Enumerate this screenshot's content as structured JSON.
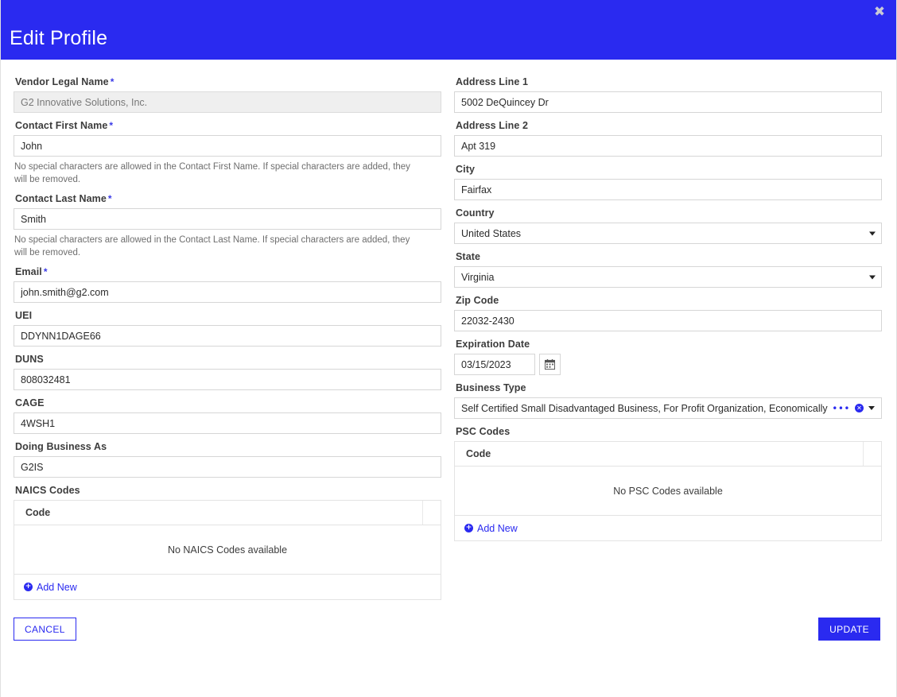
{
  "header": {
    "title": "Edit Profile",
    "close_icon": "close-icon",
    "close_glyph": "✖",
    "background_color": "#2A2AF0"
  },
  "theme": {
    "accent": "#2A2AF0",
    "required_mark": "*",
    "border": "#d6d6d6",
    "disabled_bg": "#efefef",
    "text": "#2b2b2b"
  },
  "left_column": {
    "vendor_legal_name": {
      "label": "Vendor Legal Name",
      "required": true,
      "value": "G2 Innovative Solutions, Inc.",
      "disabled": true
    },
    "contact_first_name": {
      "label": "Contact First Name",
      "required": true,
      "value": "John",
      "hint": "No special characters are allowed in the Contact First Name. If special characters are added, they will be removed."
    },
    "contact_last_name": {
      "label": "Contact Last Name",
      "required": true,
      "value": "Smith",
      "hint": "No special characters are allowed in the Contact Last Name. If special characters are added, they will be removed."
    },
    "email": {
      "label": "Email",
      "required": true,
      "value": "john.smith@g2.com"
    },
    "uei": {
      "label": "UEI",
      "required": false,
      "value": "DDYNN1DAGE66"
    },
    "duns": {
      "label": "DUNS",
      "required": false,
      "value": "808032481"
    },
    "cage": {
      "label": "CAGE",
      "required": false,
      "value": "4WSH1"
    },
    "doing_business_as": {
      "label": "Doing Business As",
      "required": false,
      "value": "G2IS"
    },
    "naics": {
      "label": "NAICS Codes",
      "column_header": "Code",
      "empty_message": "No NAICS Codes available",
      "rows": [],
      "add_new_label": "Add New",
      "add_new_icon": "plus-circle-icon",
      "add_new_glyph": "+"
    }
  },
  "right_column": {
    "address_line_1": {
      "label": "Address Line 1",
      "required": false,
      "value": "5002 DeQuincey Dr"
    },
    "address_line_2": {
      "label": "Address Line 2",
      "required": false,
      "value": "Apt 319"
    },
    "city": {
      "label": "City",
      "required": false,
      "value": "Fairfax"
    },
    "country": {
      "label": "Country",
      "required": false,
      "value": "United States",
      "options": [
        "United States"
      ],
      "caret_icon": "chevron-down-icon"
    },
    "state": {
      "label": "State",
      "required": false,
      "value": "Virginia",
      "options": [
        "Virginia"
      ],
      "caret_icon": "chevron-down-icon"
    },
    "zip_code": {
      "label": "Zip Code",
      "required": false,
      "value": "22032-2430"
    },
    "expiration_date": {
      "label": "Expiration Date",
      "required": false,
      "value": "03/15/2023",
      "calendar_icon": "calendar-icon"
    },
    "business_type": {
      "label": "Business Type",
      "required": false,
      "value": "Self Certified Small Disadvantaged Business, For Profit Organization, Economically Disadvantaged",
      "ellipsis_icon": "ellipsis-icon",
      "ellipsis_glyph": "•••",
      "clear_icon": "clear-circle-icon",
      "clear_glyph": "✕",
      "caret_icon": "chevron-down-icon"
    },
    "psc": {
      "label": "PSC Codes",
      "column_header": "Code",
      "empty_message": "No PSC Codes available",
      "rows": [],
      "add_new_label": "Add New",
      "add_new_icon": "plus-circle-icon",
      "add_new_glyph": "+"
    }
  },
  "footer": {
    "cancel_label": "CANCEL",
    "update_label": "UPDATE"
  }
}
